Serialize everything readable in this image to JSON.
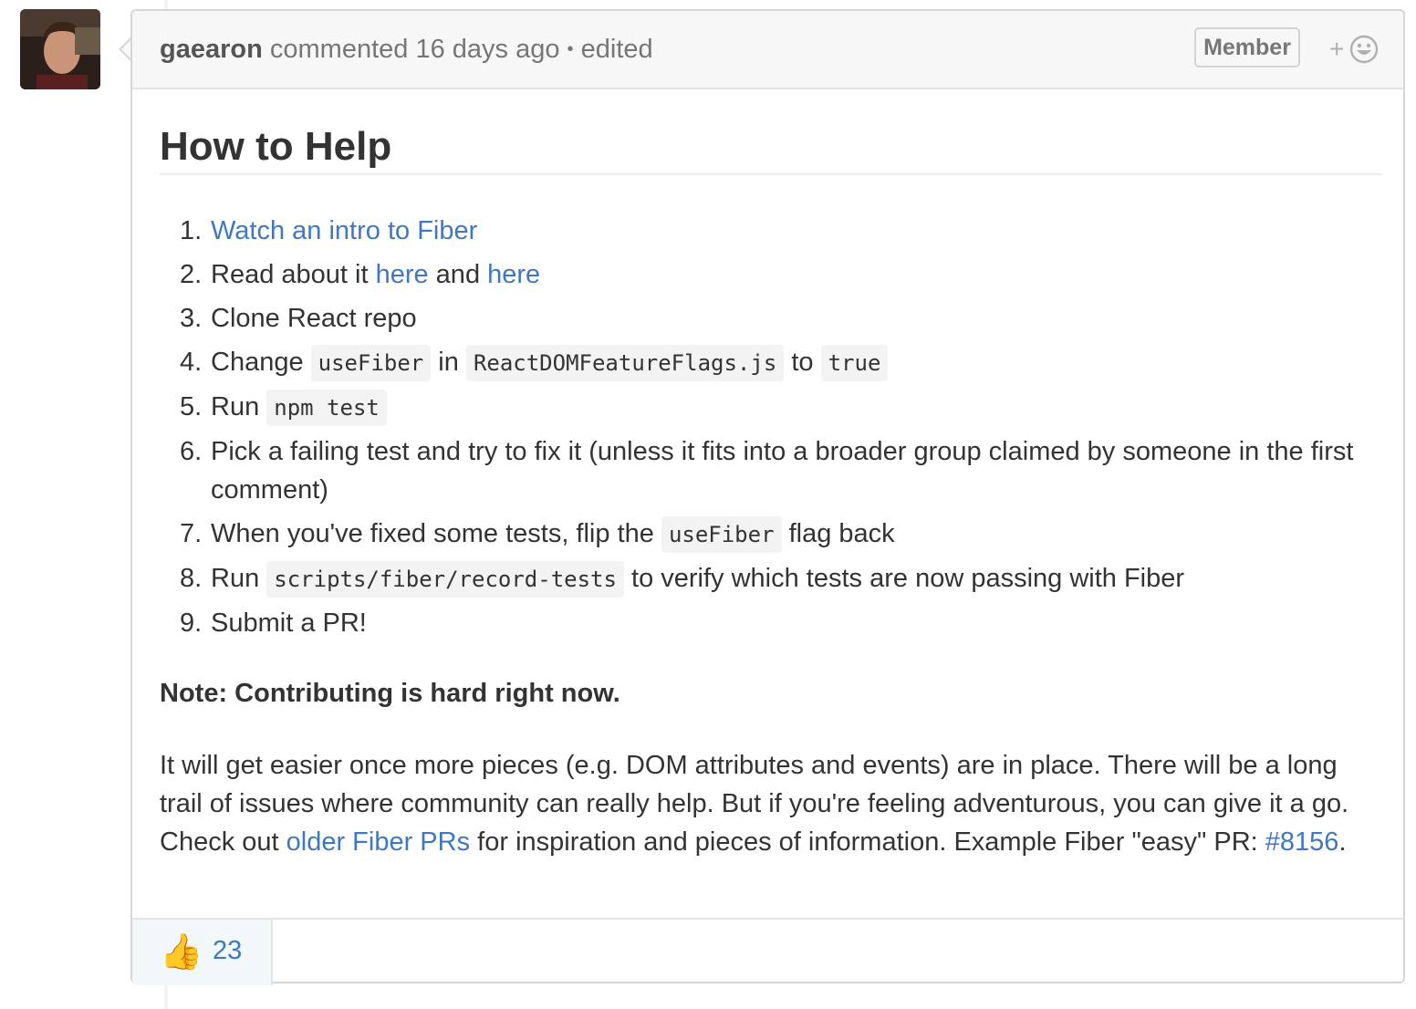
{
  "comment": {
    "author": "gaearon",
    "action": "commented",
    "time": "16 days ago",
    "separator": "•",
    "edited": "edited",
    "badge": "Member",
    "add_reaction_plus": "+",
    "add_reaction_icon": "smiley-icon"
  },
  "content": {
    "heading": "How to Help",
    "steps": [
      {
        "num": "1.",
        "link": "Watch an intro to Fiber"
      },
      {
        "num": "2.",
        "text1": "Read about it ",
        "link1": "here",
        "text2": " and ",
        "link2": "here"
      },
      {
        "num": "3.",
        "text": "Clone React repo"
      },
      {
        "num": "4.",
        "text1": "Change ",
        "code1": "useFiber",
        "text2": " in ",
        "code2": "ReactDOMFeatureFlags.js",
        "text3": " to ",
        "code3": "true"
      },
      {
        "num": "5.",
        "text1": "Run ",
        "code1": "npm test"
      },
      {
        "num": "6.",
        "text": "Pick a failing test and try to fix it (unless it fits into a broader group claimed by someone in the first comment)"
      },
      {
        "num": "7.",
        "text1": "When you've fixed some tests, flip the ",
        "code1": "useFiber",
        "text2": " flag back"
      },
      {
        "num": "8.",
        "text1": "Run ",
        "code1": "scripts/fiber/record-tests",
        "text2": " to verify which tests are now passing with Fiber"
      },
      {
        "num": "9.",
        "text": "Submit a PR!"
      }
    ],
    "note": "Note: Contributing is hard right now.",
    "paragraph": {
      "text1": "It will get easier once more pieces (e.g. DOM attributes and events) are in place. There will be a long trail of issues where community can really help. But if you're feeling adventurous, you can give it a go. Check out ",
      "link1": "older Fiber PRs",
      "text2": " for inspiration and pieces of information. Example Fiber \"easy\" PR: ",
      "link2": "#8156",
      "text3": "."
    }
  },
  "reactions": [
    {
      "emoji": "👍",
      "icon": "thumbs-up-icon",
      "count": "23"
    }
  ],
  "colors": {
    "link": "#4078c0",
    "header_bg": "#f7f7f7",
    "reaction_bg": "#f2f8fa"
  }
}
